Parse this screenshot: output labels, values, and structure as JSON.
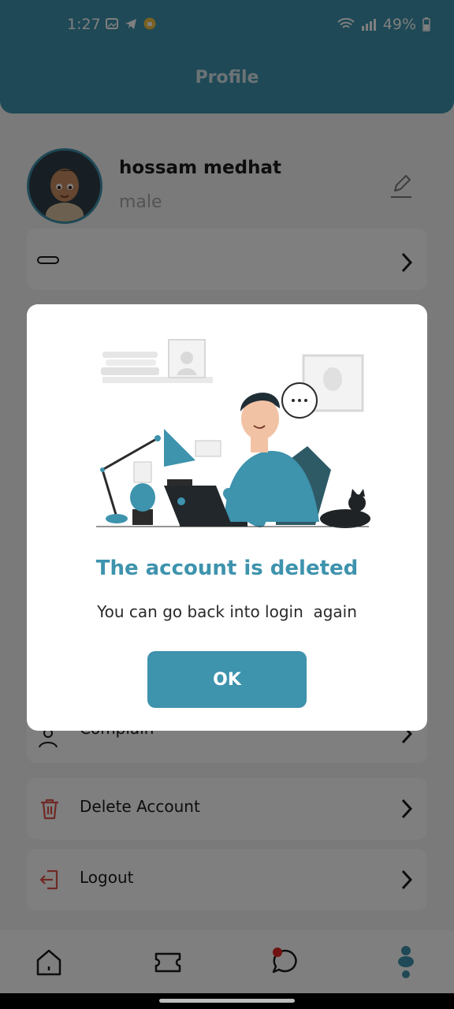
{
  "status_bar": {
    "time": "1:27",
    "battery": "49%"
  },
  "header": {
    "title": "Profile"
  },
  "profile": {
    "name": "hossam medhat",
    "gender": "male"
  },
  "menu": {
    "complain_label": "Complain",
    "delete_label": "Delete Account",
    "logout_label": "Logout"
  },
  "dialog": {
    "title": "The account is deleted",
    "message": "You can go back into login  again",
    "ok_label": "OK"
  },
  "colors": {
    "accent": "#3e93ad",
    "danger": "#e0534b",
    "dialog_title": "#3e93ad"
  },
  "icons": {
    "edit": "pencil-icon",
    "complain": "complain-icon",
    "delete": "trash-icon",
    "logout": "logout-icon",
    "nav_home": "home-icon",
    "nav_tickets": "ticket-icon",
    "nav_chat": "chat-icon",
    "nav_profile": "profile-icon"
  }
}
